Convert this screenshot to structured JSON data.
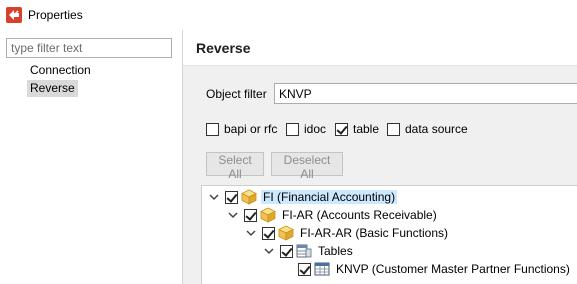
{
  "window": {
    "title": "Properties"
  },
  "sidebar": {
    "filter_placeholder": "type filter text",
    "items": [
      {
        "label": "Connection",
        "selected": false
      },
      {
        "label": "Reverse",
        "selected": true
      }
    ]
  },
  "page": {
    "title": "Reverse",
    "object_filter_label": "Object filter",
    "object_filter_value": "KNVP",
    "type_filters": [
      {
        "label": "bapi or rfc",
        "checked": false
      },
      {
        "label": "idoc",
        "checked": false
      },
      {
        "label": "table",
        "checked": true
      },
      {
        "label": "data source",
        "checked": false
      }
    ],
    "select_all_label": "Select All",
    "deselect_all_label": "Deselect All"
  },
  "tree": [
    {
      "label": "FI (Financial Accounting)",
      "level": 0,
      "expanded": true,
      "checked": true,
      "icon": "package-icon",
      "selected": true
    },
    {
      "label": "FI-AR (Accounts Receivable)",
      "level": 1,
      "expanded": true,
      "checked": true,
      "icon": "package-icon",
      "selected": false
    },
    {
      "label": "FI-AR-AR (Basic Functions)",
      "level": 2,
      "expanded": true,
      "checked": true,
      "icon": "package-icon",
      "selected": false
    },
    {
      "label": "Tables",
      "level": 3,
      "expanded": true,
      "checked": true,
      "icon": "tables-folder-icon",
      "selected": false
    },
    {
      "label": "KNVP (Customer Master Partner Functions)",
      "level": 4,
      "expanded": false,
      "checked": true,
      "icon": "table-icon",
      "selected": false
    }
  ],
  "colors": {
    "selection": "#cce8ff",
    "pane_background": "#f0f0f0",
    "brand_icon": "#d9402b"
  }
}
